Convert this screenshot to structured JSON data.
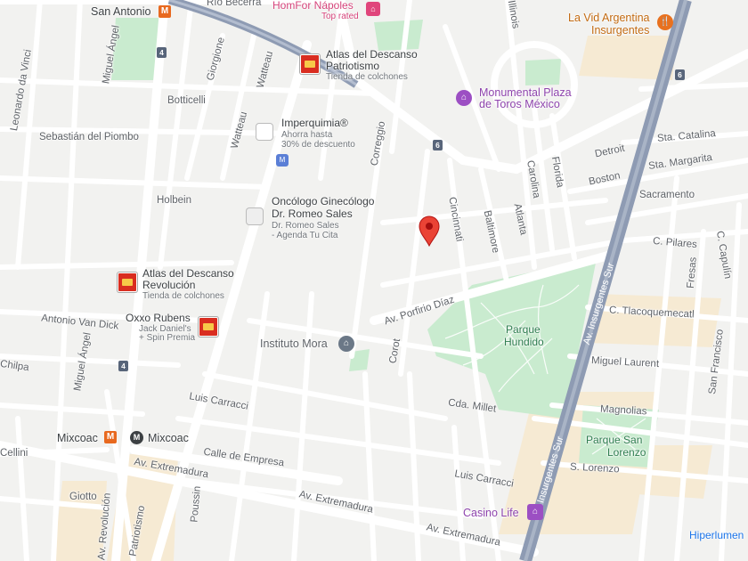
{
  "streets": {
    "rio_becerra": "Río Becerra",
    "leonardo_da_vinci": "Leonardo da Vinci",
    "miguel_angel_top": "Miguel Ángel",
    "giorgione": "Giorgione",
    "watteau1": "Watteau",
    "watteau2": "Watteau",
    "botticelli": "Botticelli",
    "sebastian_del_piombo": "Sebastián del Piombo",
    "holbein": "Holbein",
    "correggio": "Correggio",
    "illinois": "Illinois",
    "cincinnati": "Cincinnati",
    "baltimore": "Baltimore",
    "atlanta": "Atlanta",
    "carolina": "Carolina",
    "florida": "Florida",
    "detroit": "Detroit",
    "boston": "Boston",
    "sta_catalina": "Sta. Catalina",
    "sta_margarita": "Sta. Margarita",
    "sacramento": "Sacramento",
    "c_pilares": "C. Pilares",
    "c_capulin": "C. Capulín",
    "fresas": "Fresas",
    "av_porfirio_diaz": "Av. Porfirio Díaz",
    "antonio_van_dick": "Antonio Van Dick",
    "chilpa": "Chilpa",
    "miguel_angel_bottom": "Miguel Ángel",
    "corot": "Corot",
    "luis_carracci_top": "Luis Carracci",
    "cda_millet": "Cda. Millet",
    "c_tlacoquemecatl": "C. Tlacoquemecatl",
    "miguel_laurent": "Miguel Laurent",
    "magnolias": "Magnolias",
    "s_lorenzo": "S. Lorenzo",
    "av_insurgentes_sur_top": "Av. Insurgentes Sur",
    "av_insurgentes_sur_bottom": "Av. Insurgentes Sur",
    "calle_de_empresa": "Calle de Empresa",
    "av_extremadura_1": "Av. Extremadura",
    "av_extremadura_2": "Av. Extremadura",
    "av_extremadura_3": "Av. Extremadura",
    "luis_carracci_bottom": "Luis Carracci",
    "cellini": "Cellini",
    "giotto": "Giotto",
    "av_revolucion": "Av. Revolución",
    "patriotismo": "Patriotismo",
    "poussin": "Poussin",
    "san_francisco": "San Francisco"
  },
  "shields": {
    "s1": "4",
    "s2": "4",
    "s3": "6",
    "s4": "6"
  },
  "places": {
    "san_antonio": "San Antonio",
    "homfor_napoles": "HomFor Nápoles",
    "homfor_sub": "Top rated",
    "vid_argentina_1": "La Vid Argentina",
    "vid_argentina_2": "Insurgentes",
    "atlas_patriotismo_1": "Atlas del Descanso",
    "atlas_patriotismo_2": "Patriotismo",
    "atlas_patriotismo_sub": "Tienda de colchones",
    "monumental_1": "Monumental Plaza",
    "monumental_2": "de Toros México",
    "imperquimia": "Imperquimia®",
    "imperquimia_sub1": "Ahorra hasta",
    "imperquimia_sub2": "30% de descuento",
    "oncologo_1": "Oncólogo Ginecólogo",
    "oncologo_2": "Dr. Romeo Sales",
    "oncologo_sub1": "Dr. Romeo Sales",
    "oncologo_sub2": "- Agenda Tu Cita",
    "atlas_revolucion_1": "Atlas del Descanso",
    "atlas_revolucion_2": "Revolución",
    "atlas_revolucion_sub": "Tienda de colchones",
    "oxxo": "Oxxo Rubens",
    "oxxo_sub1": "Jack Daniel's",
    "oxxo_sub2": "+ Spin Premia",
    "instituto_mora": "Instituto Mora",
    "parque_hundido_1": "Parque",
    "parque_hundido_2": "Hundido",
    "parque_san_lorenzo_1": "Parque San",
    "parque_san_lorenzo_2": "Lorenzo",
    "mixcoac_left": "Mixcoac",
    "mixcoac_metro": "Mixcoac",
    "casino_life": "Casino Life",
    "hiperlumen": "Hiperlumen"
  },
  "icon_glyphs": {
    "metro": "M",
    "metro_bus": "M",
    "fork": "🍴",
    "bed": "▬",
    "pin": "⌂",
    "school": "⌂"
  },
  "colors": {
    "background": "#f2f2f0",
    "road": "#ffffff",
    "road_edge": "#dadce0",
    "highway": "#8e9bb3",
    "park": "#c9ebcf",
    "block_tan": "#f6ead3",
    "pin_red": "#ea4335",
    "metro_orange": "#e8691f"
  },
  "selected_pin": "red-location-pin"
}
